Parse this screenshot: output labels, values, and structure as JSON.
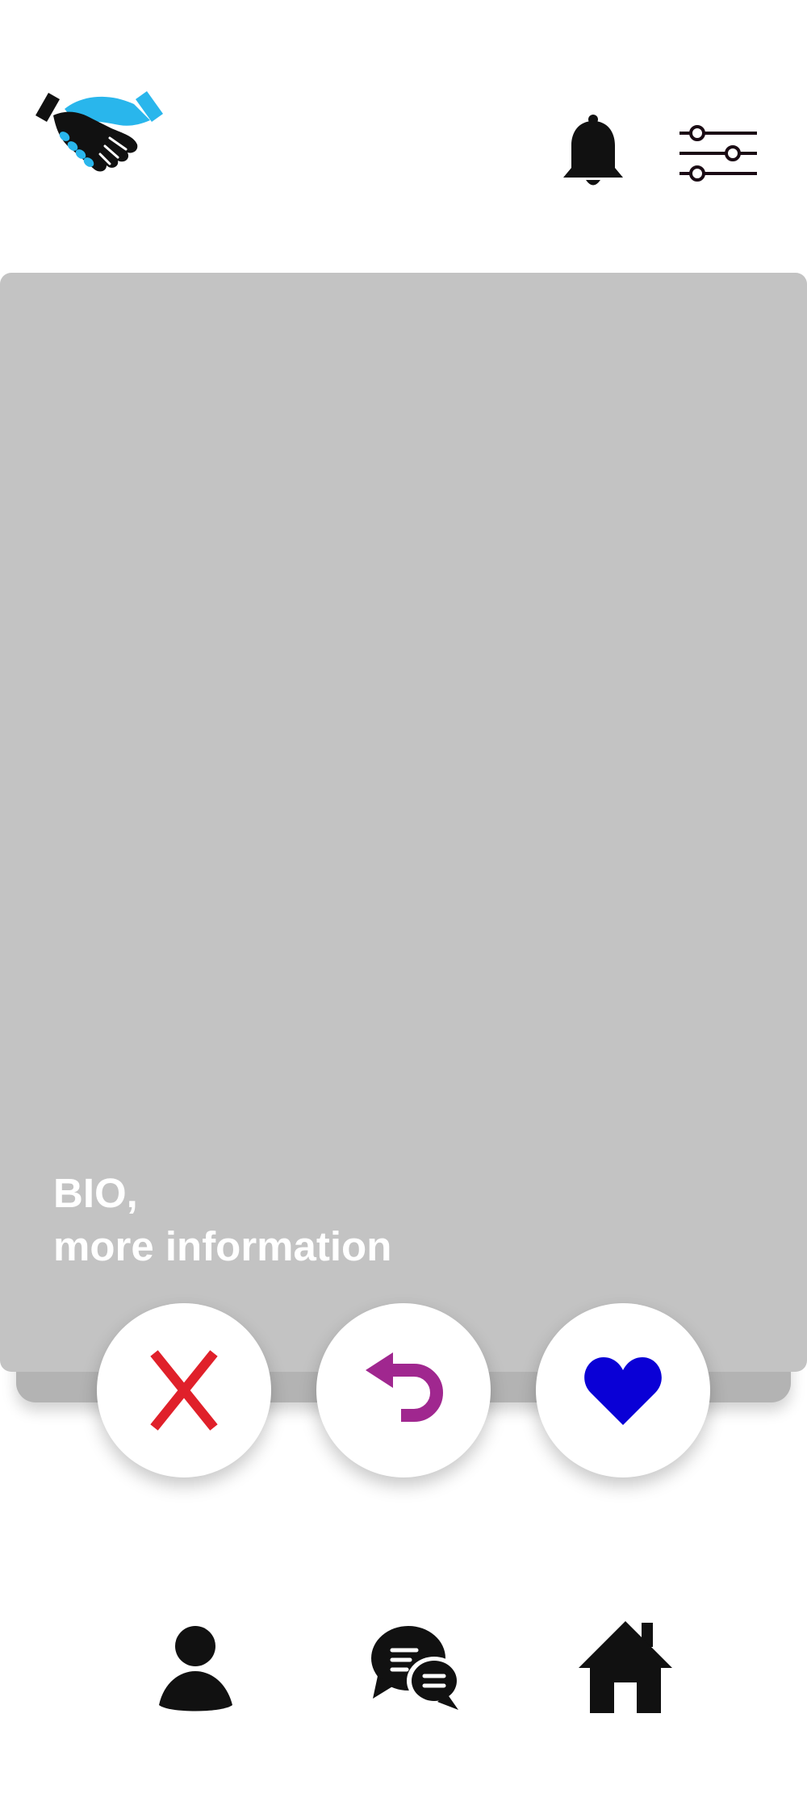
{
  "app": {
    "logo_icon": "handshake-icon",
    "colors": {
      "brand_blue": "#29b6ec",
      "card_gray": "#c3c3c3",
      "reject_red": "#e0202a",
      "undo_purple": "#a0278f",
      "like_blue": "#0a00d6"
    }
  },
  "header": {
    "notifications_icon": "bell-icon",
    "filters_icon": "sliders-icon"
  },
  "profile_card": {
    "bio_line1": "BIO,",
    "bio_line2": "more information"
  },
  "actions": {
    "reject_icon": "x-icon",
    "undo_icon": "undo-arrow-icon",
    "like_icon": "heart-icon"
  },
  "bottom_nav": {
    "items": [
      "profile-icon",
      "chat-bubbles-icon",
      "home-icon"
    ]
  }
}
